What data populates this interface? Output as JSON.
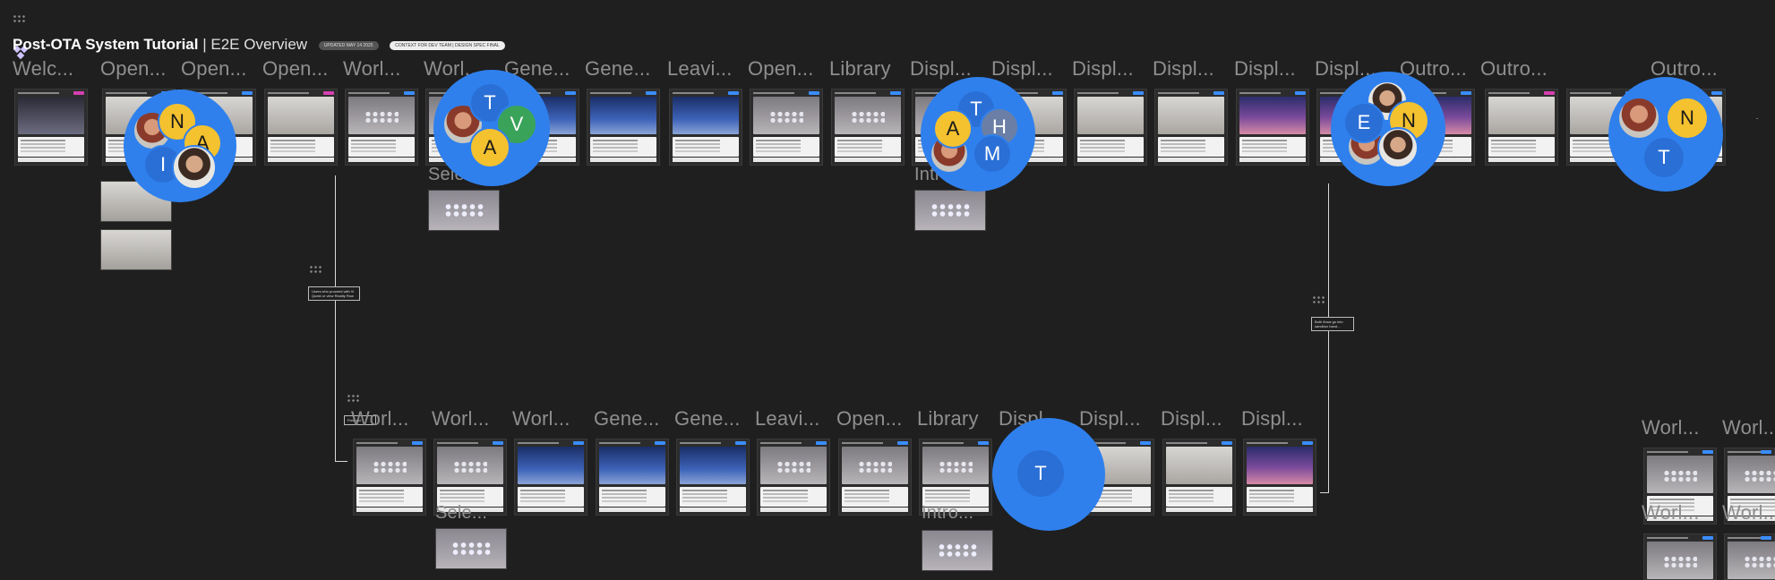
{
  "doc_title": {
    "bold": "Post-OTA System Tutorial",
    "rest": " | E2E Overview"
  },
  "pills": [
    "UPDATED MAY 14 2025",
    "CONTEXT FOR DEV TEAM | DESIGN SPEC FINAL"
  ],
  "top_headers": [
    "Welc...",
    "Open...",
    "Open...",
    "Open...",
    "Worl...",
    "Worl...",
    "Gene...",
    "Gene...",
    "Leavi...",
    "Open...",
    "Library",
    "Displ...",
    "Displ...",
    "Displ...",
    "Displ...",
    "Displ...",
    "Displ...",
    "Outro...",
    "Outro...",
    "Outro..."
  ],
  "sub_headers": [
    "Sele...",
    "Intro..."
  ],
  "bottom_headers": [
    "Worl...",
    "Worl...",
    "Worl...",
    "Gene...",
    "Gene...",
    "Leavi...",
    "Open...",
    "Library",
    "Displ...",
    "Displ...",
    "Displ...",
    "Displ..."
  ],
  "bottom_sub_headers": [
    "Sele...",
    "Intro..."
  ],
  "right_headers": [
    "Worl...",
    "Worl...",
    "Worl...",
    "Worl..."
  ],
  "notes": [
    "Users who proceed with Vi Quest or view Reality Row",
    "Both flows go into sandbox hand...",
    "Prebuild"
  ],
  "avatar_clusters": [
    {
      "members": [
        "N",
        "A",
        "I"
      ]
    },
    {
      "members": [
        "T",
        "V",
        "A"
      ]
    },
    {
      "members": [
        "T",
        "A",
        "H",
        "M"
      ]
    },
    {
      "members": [
        "E",
        "N"
      ]
    },
    {
      "members": [
        "N",
        "T"
      ]
    },
    {
      "members": [
        "T"
      ]
    }
  ],
  "colors": {
    "background": "#1f1f1f",
    "cluster": "#2f80ed",
    "avatar_yellow": "#f4c12f",
    "avatar_green": "#3aa35a"
  }
}
